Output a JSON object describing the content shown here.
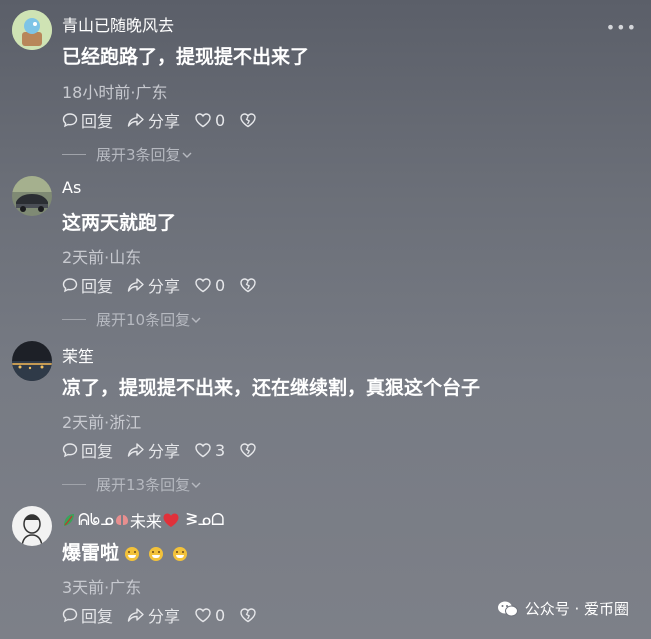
{
  "more_icon": "more-options-icon",
  "comments": [
    {
      "username": "青山已随晚风去",
      "text": "已经跑路了，提现提不出来了",
      "meta": "18小时前·广东",
      "reply_label": "回复",
      "share_label": "分享",
      "likes": "0",
      "expand_label": "展开3条回复"
    },
    {
      "username": "As",
      "text": "这两天就跑了",
      "meta": "2天前·山东",
      "reply_label": "回复",
      "share_label": "分享",
      "likes": "0",
      "expand_label": "展开10条回复"
    },
    {
      "username": "茉笙",
      "text": "凉了，提现提不出来，还在继续割，真狠这个台子",
      "meta": "2天前·浙江",
      "reply_label": "回复",
      "share_label": "分享",
      "likes": "3",
      "expand_label": "展开13条回复"
    },
    {
      "username_pre": "ᕱᖚᓄ",
      "username_mid": "未来",
      "username_post": "ᕒᓄᗝ",
      "text": "爆雷啦",
      "meta": "3天前·广东",
      "reply_label": "回复",
      "share_label": "分享",
      "likes": "0"
    }
  ],
  "watermark": "公众号 · 爱币圈",
  "colors": {
    "background": "#6b6f78",
    "text": "#ffffff",
    "meta": "#c8cad0"
  }
}
